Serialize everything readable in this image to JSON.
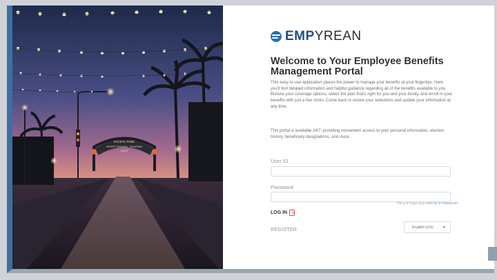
{
  "brand": {
    "logo_bold": "EMP",
    "logo_rest": "YREAN",
    "accent": "#1f4f86"
  },
  "photo": {
    "arch_line1": "PACIFIC PARK",
    "arch_line2": "SPORT FISHING · BOATING",
    "arch_line3": "CAFES"
  },
  "page": {
    "title": "Welcome to Your Employee Benefits Management Portal",
    "paragraph1": "This easy-to-use application places the power to manage your benefits at your fingertips. Here you'll find detailed information and helpful guidance regarding all of the benefits available to you. Browse your coverage options, select the plan that's right for you and your family, and enroll in your benefits with just a few clicks. Come back to review your selections and update your information at any time.",
    "paragraph2": "This portal is available 24/7, providing convenient access to your personal information, election history, beneficiary designations, and more."
  },
  "form": {
    "user_id_label": "User ID",
    "user_id_value": "",
    "password_label": "Password",
    "password_value": "",
    "forgot_prefix": "Did you forget your ",
    "forgot_link": "User ID or Password?",
    "login_label": "LOG IN",
    "register_label": "REGISTER",
    "language_selected": "English (US)"
  },
  "icons": {
    "logo": "empyrean-logo-icon",
    "login": "login-arrow-icon",
    "caret": "chevron-down-icon"
  }
}
